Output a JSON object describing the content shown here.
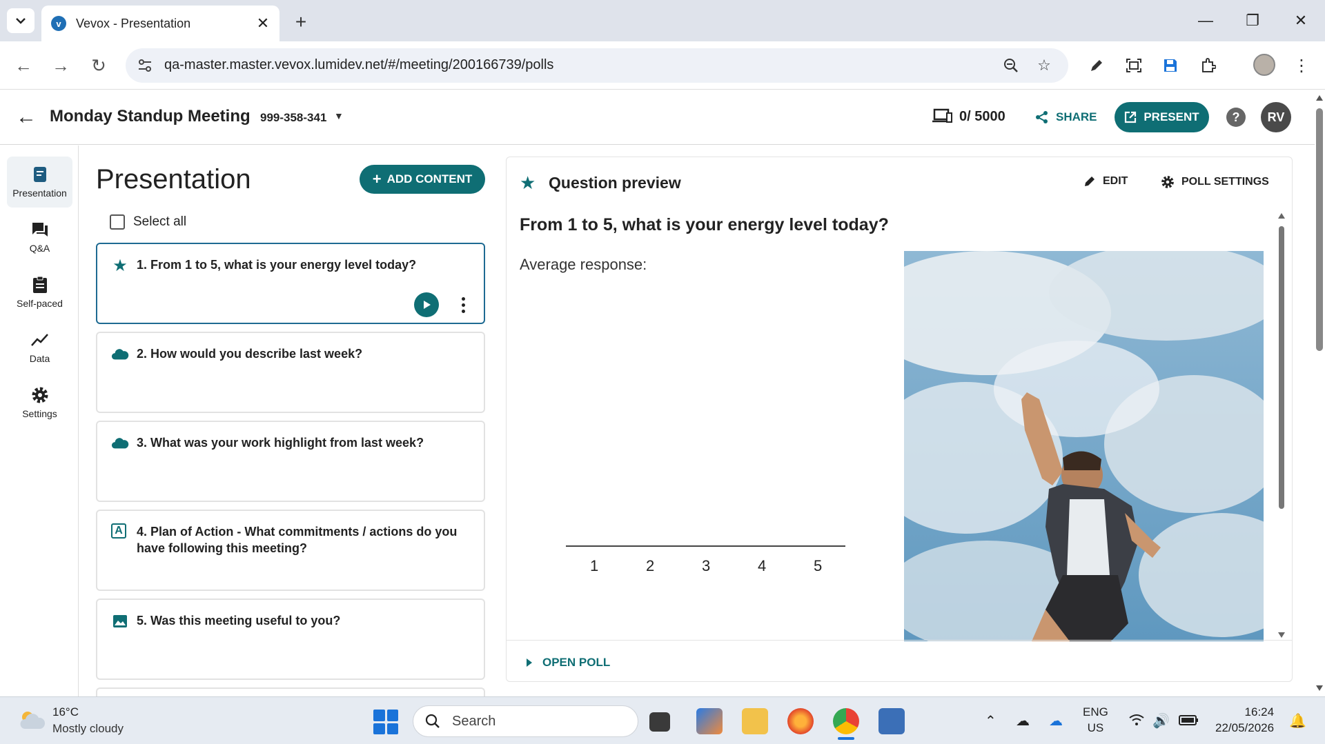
{
  "browser": {
    "tab_title": "Vevox - Presentation",
    "url": "qa-master.master.vevox.lumidev.net/#/meeting/200166739/polls"
  },
  "header": {
    "meeting_title": "Monday Standup Meeting",
    "meeting_id": "999-358-341",
    "participants": "0/ 5000",
    "share_label": "SHARE",
    "present_label": "PRESENT",
    "avatar_initials": "RV"
  },
  "nav": {
    "items": [
      {
        "label": "Presentation",
        "icon": "presentation-icon",
        "active": true
      },
      {
        "label": "Q&A",
        "icon": "chat-icon"
      },
      {
        "label": "Self-paced",
        "icon": "clipboard-icon"
      },
      {
        "label": "Data",
        "icon": "chart-line-icon"
      },
      {
        "label": "Settings",
        "icon": "gear-icon"
      }
    ]
  },
  "panel": {
    "title": "Presentation",
    "add_content_label": "ADD CONTENT",
    "select_all_label": "Select all",
    "polls": [
      {
        "title": "1. From 1 to 5, what is your energy level today?",
        "icon": "star-icon"
      },
      {
        "title": "2. How would you describe last week?",
        "icon": "cloud-icon"
      },
      {
        "title": "3. What was your work highlight from last week?",
        "icon": "cloud-icon"
      },
      {
        "title": "4. Plan of Action - What commitments / actions do you have following this meeting?",
        "icon": "text-a-icon"
      },
      {
        "title": "5. Was this meeting useful to you?",
        "icon": "image-icon"
      }
    ]
  },
  "preview": {
    "title": "Question preview",
    "edit_label": "EDIT",
    "poll_settings_label": "POLL SETTINGS",
    "question": "From 1 to 5, what is your energy level today?",
    "average_label": "Average response:",
    "scale": [
      "1",
      "2",
      "3",
      "4",
      "5"
    ],
    "open_poll_label": "OPEN POLL"
  },
  "taskbar": {
    "weather_temp": "16°C",
    "weather_desc": "Mostly cloudy",
    "search_placeholder": "Search",
    "lang_line1": "ENG",
    "lang_line2": "US",
    "time": "16:24",
    "date": "22/05/2026"
  },
  "colors": {
    "accent": "#0f6e74",
    "selected_border": "#1e6a92"
  }
}
